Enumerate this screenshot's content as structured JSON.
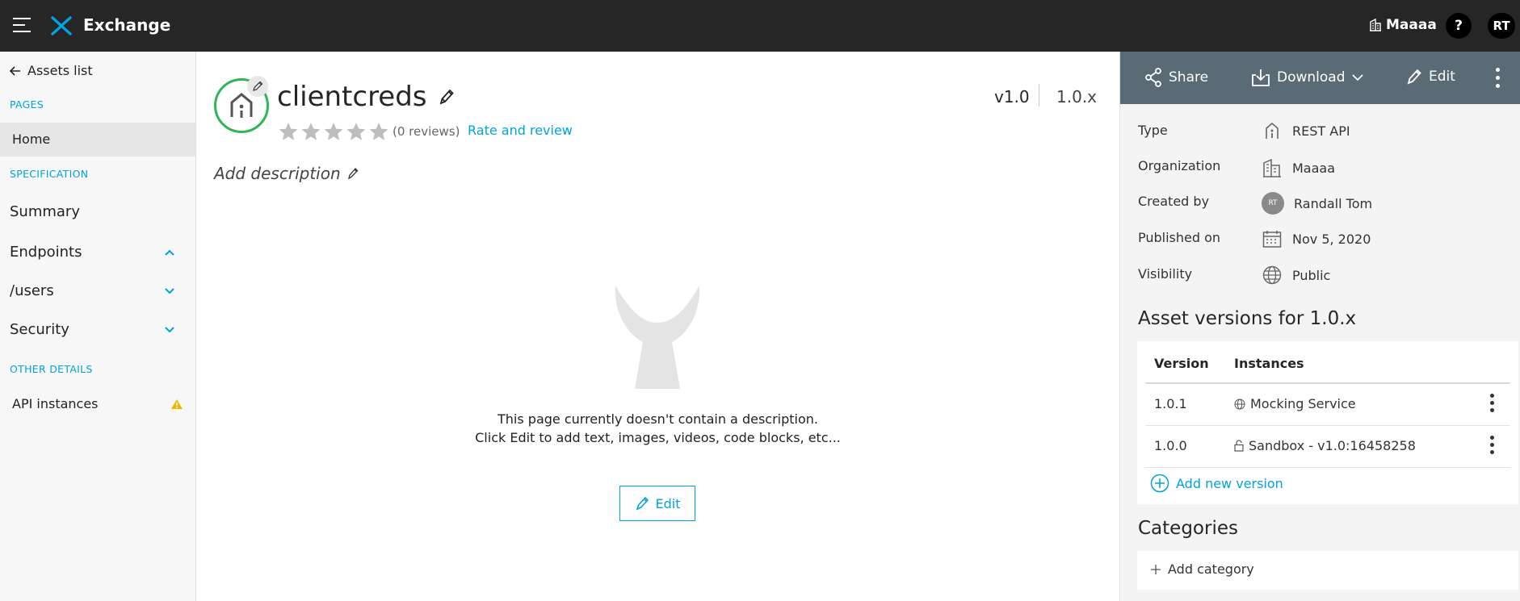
{
  "topbar": {
    "brand": "Exchange",
    "org": "Maaaa",
    "help": "?",
    "user_initials": "RT",
    "icons": [
      "hamburger-icon",
      "exchange-logo-icon",
      "building-icon"
    ]
  },
  "sidebar": {
    "back_label": "Assets list",
    "pages_label": "PAGES",
    "home_label": "Home",
    "spec_label": "SPECIFICATION",
    "summary_label": "Summary",
    "endpoints_label": "Endpoints",
    "users_label": "/users",
    "security_label": "Security",
    "other_label": "OTHER DETAILS",
    "api_instances_label": "API instances"
  },
  "asset": {
    "name": "clientcreds",
    "version": "v1.0",
    "version_group": "1.0.x",
    "reviews": "(0 reviews)",
    "rating": 0,
    "rating_max": 5,
    "rate_link": "Rate and review",
    "add_description": "Add description",
    "empty_line1": "This page currently doesn't contain a description.",
    "empty_line2": "Click Edit to add text, images, videos, code blocks, etc...",
    "edit_label": "Edit"
  },
  "toolbar": {
    "share": "Share",
    "download": "Download",
    "edit": "Edit"
  },
  "meta": {
    "type_label": "Type",
    "type_value": "REST API",
    "org_label": "Organization",
    "org_value": "Maaaa",
    "created_label": "Created by",
    "created_initials": "RT",
    "created_value": "Randall Tom",
    "published_label": "Published on",
    "published_value": "Nov 5, 2020",
    "visibility_label": "Visibility",
    "visibility_value": "Public"
  },
  "versions": {
    "heading": "Asset versions for 1.0.x",
    "col_version": "Version",
    "col_instances": "Instances",
    "rows": [
      {
        "version": "1.0.1",
        "instance": "Mocking Service",
        "icon": "globe-icon"
      },
      {
        "version": "1.0.0",
        "instance": "Sandbox - v1.0:16458258",
        "icon": "lock-icon"
      }
    ],
    "add_label": "Add new version"
  },
  "categories": {
    "heading": "Categories",
    "add_label": "Add category"
  },
  "colors": {
    "accent": "#00a2df",
    "topbar": "#262626",
    "toolbar": "#5a6b76",
    "asset_ring": "#2fb552",
    "warning": "#f0b400"
  }
}
